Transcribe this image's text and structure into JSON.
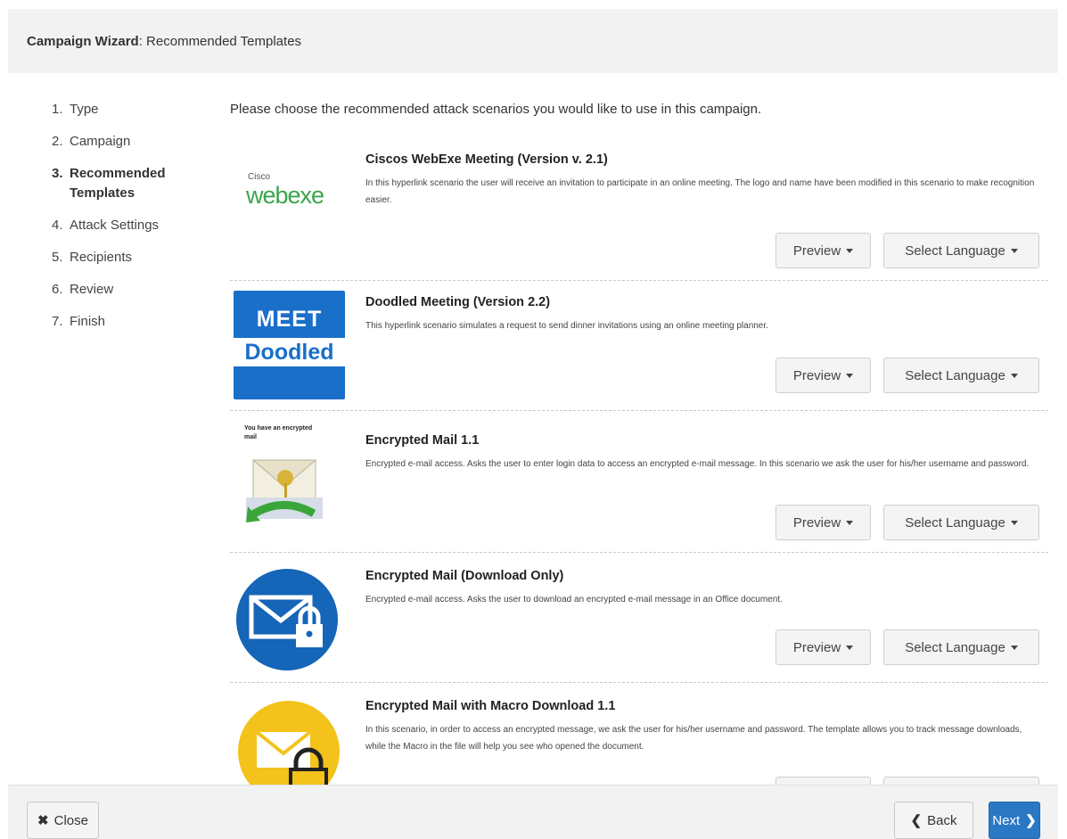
{
  "header": {
    "title_bold": "Campaign Wizard",
    "title_rest": ": Recommended Templates"
  },
  "steps": [
    {
      "num": "1.",
      "label": "Type"
    },
    {
      "num": "2.",
      "label": "Campaign"
    },
    {
      "num": "3.",
      "label": "Recommended Templates"
    },
    {
      "num": "4.",
      "label": "Attack Settings"
    },
    {
      "num": "5.",
      "label": "Recipients"
    },
    {
      "num": "6.",
      "label": "Review"
    },
    {
      "num": "7.",
      "label": "Finish"
    }
  ],
  "intro": "Please choose the recommended attack scenarios you would like to use in this campaign.",
  "templates": [
    {
      "title": "Ciscos WebExe Meeting (Version v. 2.1)",
      "description": "In this hyperlink scenario the user will receive an invitation to participate in an online meeting. The logo and name have been modified in this scenario to make recognition easier.",
      "logo_small": "Cisco",
      "logo_big": "webexe"
    },
    {
      "title": "Doodled Meeting (Version 2.2)",
      "description": "This hyperlink scenario simulates a request to send dinner invitations using an online meeting planner.",
      "logo_top": "MEET",
      "logo_bottom": "Doodled"
    },
    {
      "title": "Encrypted Mail 1.1",
      "description": "Encrypted e-mail access. Asks the user to enter login data to access an encrypted e-mail message. In this scenario we ask the user for his/her username and password.",
      "logo_caption": "You have an encrypted mail"
    },
    {
      "title": "Encrypted Mail (Download Only)",
      "description": "Encrypted e-mail access. Asks the user to download an encrypted e-mail message in an Office document."
    },
    {
      "title": "Encrypted Mail with Macro Download 1.1",
      "description": "In this scenario, in order to access an encrypted message, we ask the user for his/her username and password. The template allows you to track message downloads, while the Macro in the file will help you see who opened the document."
    }
  ],
  "buttons": {
    "preview": "Preview",
    "select_language": "Select Language"
  },
  "footer": {
    "close": "Close",
    "back": "Back",
    "next": "Next"
  },
  "colors": {
    "primary": "#2a78c4",
    "doodle_blue": "#1a6fc9",
    "mail_blue": "#1565b8",
    "mail_yellow": "#f3c21b"
  }
}
